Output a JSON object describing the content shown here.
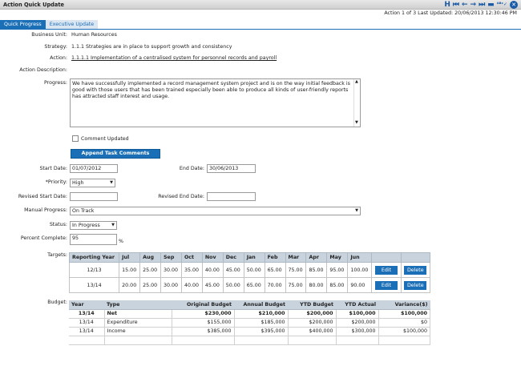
{
  "window": {
    "title": "Action Quick Update"
  },
  "toolbar": {
    "home": "H",
    "first": "⏮",
    "prev": "←",
    "next": "→",
    "last": "⏭",
    "save": "▬",
    "spell": "ᴬᴮᶜ✓",
    "close": "✕"
  },
  "status": "Action 1 of 3  Last Updated: 20/06/2013 12:30:46 PM",
  "tabs": [
    {
      "label": "Quick Progress"
    },
    {
      "label": "Executive Update"
    }
  ],
  "form": {
    "business_unit_label": "Business Unit:",
    "business_unit": "Human Resources",
    "strategy_label": "Strategy:",
    "strategy": "1.1.1 Strategies are in place to support growth and consistency",
    "action_label": "Action:",
    "action": "1.1.1.1 Implementation of a centralised system for personnel records and payroll",
    "action_description_label": "Action Description:",
    "progress_label": "Progress:",
    "progress": "We have successfully implemented  a record management system project and is on the way initial feedback is good with those users that has been trained especially been able to produce all kinds of user-friendly reports has attracted staff interest and usage.",
    "comment_updated_label": "Comment Updated",
    "append_label": "Append Task Comments",
    "start_date_label": "Start Date:",
    "start_date": "01/07/2012",
    "end_date_label": "End Date:",
    "end_date": "30/06/2013",
    "priority_label": "*Priority:",
    "priority": "High",
    "revised_start_label": "Revised Start Date:",
    "revised_start": "",
    "revised_end_label": "Revised End Date:",
    "revised_end": "",
    "manual_progress_label": "Manual Progress:",
    "manual_progress": "On Track",
    "status_label": "Status:",
    "status_value": "In Progress",
    "percent_label": "Percent Complete:",
    "percent": "95",
    "percent_unit": "%",
    "targets_label": "Targets:",
    "budget_label": "Budget:"
  },
  "targets": {
    "headers": [
      "Reporting Year",
      "Jul",
      "Aug",
      "Sep",
      "Oct",
      "Nov",
      "Dec",
      "Jan",
      "Feb",
      "Mar",
      "Apr",
      "May",
      "Jun"
    ],
    "rows": [
      [
        "12/13",
        "15.00",
        "25.00",
        "30.00",
        "35.00",
        "40.00",
        "45.00",
        "50.00",
        "65.00",
        "75.00",
        "85.00",
        "95.00",
        "100.00"
      ],
      [
        "13/14",
        "20.00",
        "25.00",
        "30.00",
        "40.00",
        "45.00",
        "50.00",
        "65.00",
        "70.00",
        "75.00",
        "80.00",
        "85.00",
        "90.00"
      ]
    ],
    "edit_label": "Edit",
    "delete_label": "Delete"
  },
  "budget": {
    "headers": [
      "Year",
      "Type",
      "Original Budget",
      "Annual Budget",
      "YTD Budget",
      "YTD Actual",
      "Variance($)"
    ],
    "rows": [
      [
        "13/14",
        "Net",
        "$230,000",
        "$210,000",
        "$200,000",
        "$100,000",
        "$100,000"
      ],
      [
        "13/14",
        "Expenditure",
        "$155,000",
        "$185,000",
        "$200,000",
        "$200,000",
        "$0"
      ],
      [
        "13/14",
        "Income",
        "$385,000",
        "$395,000",
        "$400,000",
        "$300,000",
        "$100,000"
      ],
      [
        "",
        "",
        "",
        "",
        "",
        "",
        ""
      ]
    ]
  }
}
